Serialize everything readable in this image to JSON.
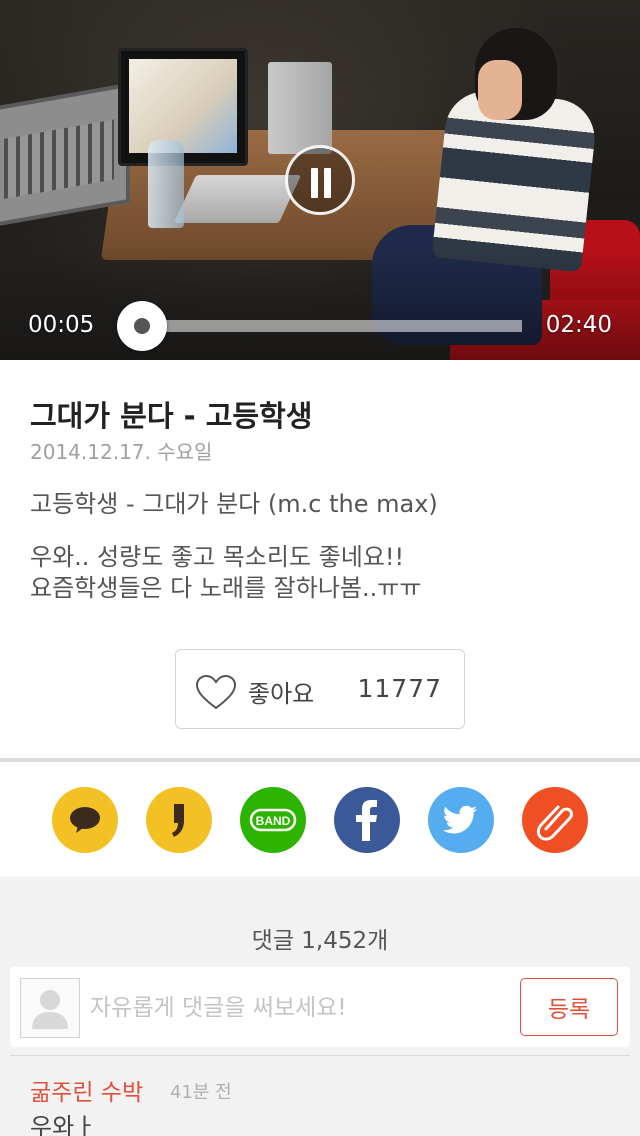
{
  "player": {
    "current_time": "00:05",
    "duration": "02:40",
    "progress": 0.03,
    "state": "playing"
  },
  "post": {
    "title": "그대가 분다 - 고등학생",
    "date": "2014.12.17. 수요일",
    "description_line1": "고등학생 - 그대가 분다 (m.c the max)",
    "description_line2a": "우와.. 성량도 좋고 목소리도 좋네요!!",
    "description_line2b": "요즘학생들은 다 노래를 잘하나봄..ㅠㅠ"
  },
  "like": {
    "label": "좋아요",
    "count": "11777",
    "icon": "heart-outline-icon"
  },
  "share": [
    {
      "name": "kakaotalk",
      "icon": "kakaotalk-icon",
      "color": "#f4c125"
    },
    {
      "name": "kakaostory",
      "icon": "kakaostory-icon",
      "color": "#f4c125"
    },
    {
      "name": "band",
      "icon": "band-icon",
      "color": "#2db400",
      "label": "BAND"
    },
    {
      "name": "facebook",
      "icon": "facebook-icon",
      "color": "#3b5998"
    },
    {
      "name": "twitter",
      "icon": "twitter-icon",
      "color": "#55acee"
    },
    {
      "name": "copy-link",
      "icon": "paperclip-icon",
      "color": "#f04e23"
    }
  ],
  "comments": {
    "count_label": "댓글 1,452개",
    "input_placeholder": "자유롭게 댓글을 써보세요!",
    "submit_label": "등록",
    "items": [
      {
        "author": "굶주린 수박",
        "time": "41분 전",
        "text": "우와ㅏ"
      }
    ]
  },
  "colors": {
    "accent": "#e0503a",
    "background": "#f2f2f2"
  }
}
